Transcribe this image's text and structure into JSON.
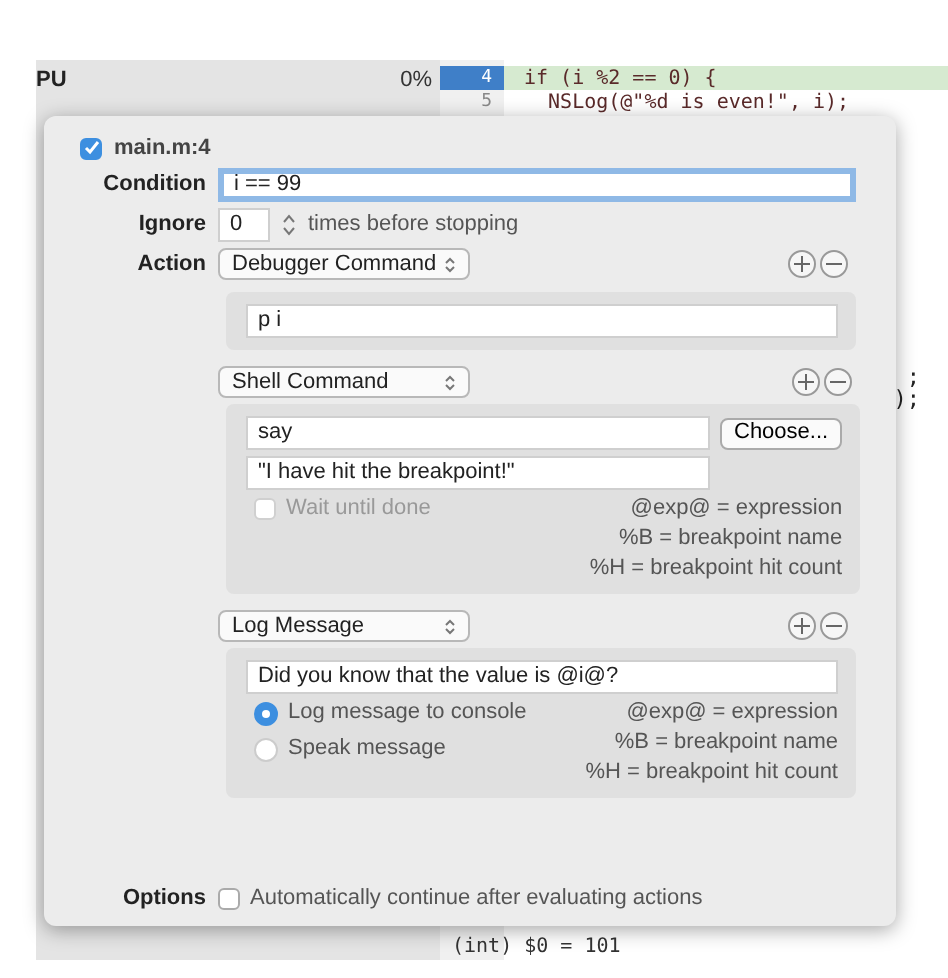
{
  "background": {
    "panel_label": "PU",
    "cpu": "0%",
    "lines": [
      {
        "number": "4",
        "code": "if (i %2 == 0) {",
        "current": true
      },
      {
        "number": "5",
        "code": "  NSLog(@\"%d is even!\", i);",
        "current": false
      }
    ],
    "fragments": [
      ";",
      ");"
    ],
    "console": "(int) $0 = 101"
  },
  "breakpoint": {
    "enabled": true,
    "name": "main.m:4"
  },
  "condition": {
    "label": "Condition",
    "value": "i == 99"
  },
  "ignore": {
    "label": "Ignore",
    "value": "0",
    "suffix": "times before stopping"
  },
  "action_label": "Action",
  "actions": [
    {
      "kind": "debugger",
      "type": "Debugger Command",
      "command": "p i"
    },
    {
      "kind": "shell",
      "type": "Shell Command",
      "command": "say",
      "button": "Choose...",
      "arguments": "\"I have hit the breakpoint!\"",
      "wait": {
        "label": "Wait until done",
        "checked": false,
        "disabled": true
      },
      "help": [
        "@exp@ = expression",
        "%B = breakpoint name",
        "%H = breakpoint hit count"
      ]
    },
    {
      "kind": "log",
      "type": "Log Message",
      "message": "Did you know that the value is @i@?",
      "outputs": [
        {
          "label": "Log message to console",
          "selected": true
        },
        {
          "label": "Speak message",
          "selected": false
        }
      ],
      "help": [
        "@exp@ = expression",
        "%B = breakpoint name",
        "%H = breakpoint hit count"
      ]
    }
  ],
  "options": {
    "label": "Options",
    "auto_continue": {
      "label": "Automatically continue after evaluating actions",
      "checked": false
    }
  }
}
